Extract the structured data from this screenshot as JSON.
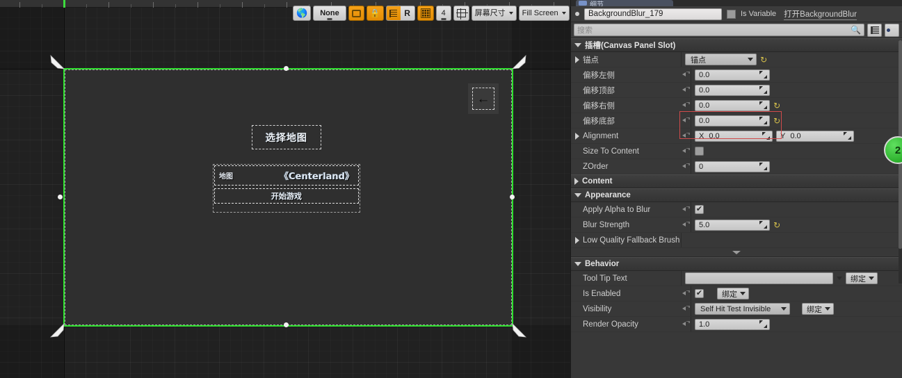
{
  "viewport": {
    "toolbar": {
      "globe_icon": "globe-icon",
      "none_label": "None",
      "fill_icon": "fill-rect-icon",
      "lock_icon": "lock-icon",
      "wrap_icon": "text-wrap-icon",
      "r_label": "R",
      "grid_icon": "grid-snap-icon",
      "grid_size": "4",
      "resize_icon": "resize-to-content-icon",
      "screen_size_label": "屏幕尺寸",
      "fill_screen_label": "Fill Screen"
    },
    "widget": {
      "title": "选择地图",
      "map_key": "地图",
      "map_value": "《Centerland》",
      "start_button": "开始游戏",
      "back_arrow": "←"
    }
  },
  "details": {
    "tab_label": "细节",
    "name_value": "BackgroundBlur_179",
    "is_variable_label": "Is Variable",
    "open_link": "打开BackgroundBlur",
    "search_placeholder": "搜索",
    "sections": {
      "slot": {
        "title": "插槽(Canvas Panel Slot)",
        "anchors_label": "锚点",
        "anchors_value": "锚点",
        "offset_left_label": "偏移左侧",
        "offset_left_value": "0.0",
        "offset_top_label": "偏移顶部",
        "offset_top_value": "0.0",
        "offset_right_label": "偏移右侧",
        "offset_right_value": "0.0",
        "offset_bottom_label": "偏移底部",
        "offset_bottom_value": "0.0",
        "alignment_label": "Alignment",
        "alignment_x_axis": "X",
        "alignment_x_value": "0.0",
        "alignment_y_axis": "Y",
        "alignment_y_value": "0.0",
        "size_to_content_label": "Size To Content",
        "size_to_content_checked": false,
        "zorder_label": "ZOrder",
        "zorder_value": "0"
      },
      "content": {
        "title": "Content"
      },
      "appearance": {
        "title": "Appearance",
        "apply_alpha_label": "Apply Alpha to Blur",
        "apply_alpha_checked": true,
        "apply_alpha_mark": "✔",
        "blur_strength_label": "Blur Strength",
        "blur_strength_value": "5.0",
        "low_quality_label": "Low Quality Fallback Brush"
      },
      "behavior": {
        "title": "Behavior",
        "tooltip_label": "Tool Tip Text",
        "tooltip_value": "",
        "tooltip_bind": "绑定",
        "is_enabled_label": "Is Enabled",
        "is_enabled_checked": true,
        "is_enabled_mark": "✔",
        "is_enabled_bind": "绑定",
        "visibility_label": "Visibility",
        "visibility_value": "Self Hit Test Invisible",
        "visibility_bind": "绑定",
        "render_opacity_label": "Render Opacity",
        "render_opacity_value": "1.0"
      }
    },
    "badge_label": "2",
    "reset_glyph": "↺",
    "colors": {
      "accent_green": "#2ee02e",
      "highlight_red": "#d14b4b",
      "reset_yellow": "#d6c14c",
      "toolbar_orange": "#e28c05"
    }
  }
}
